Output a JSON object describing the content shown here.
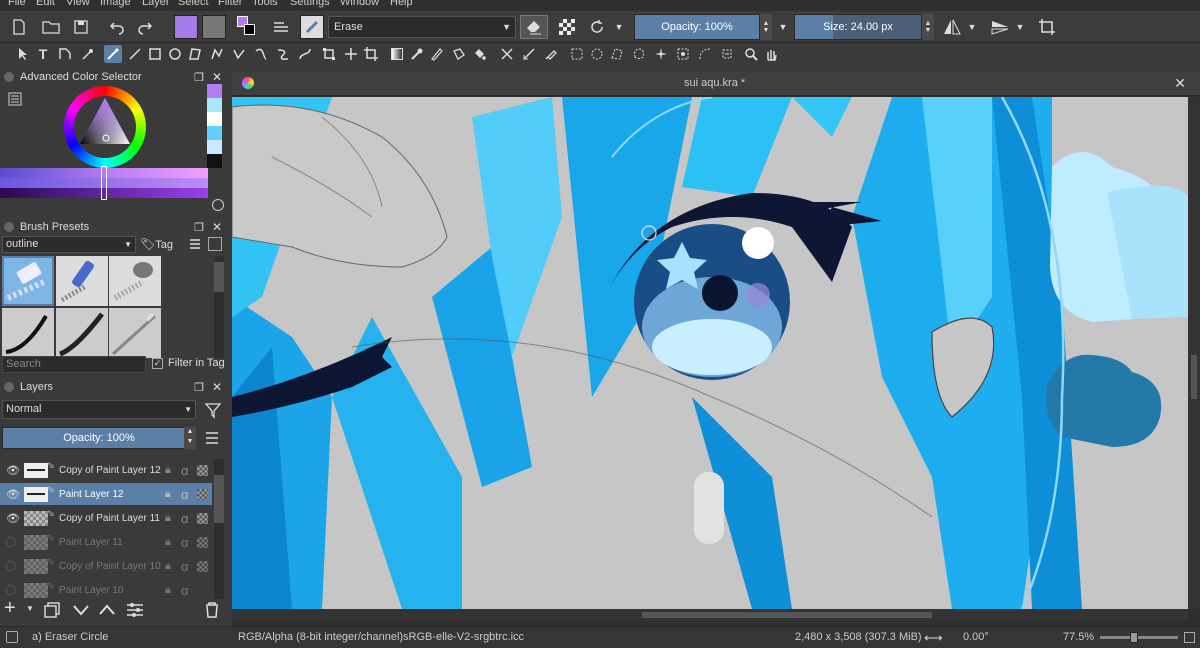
{
  "menu": [
    "File",
    "Edit",
    "View",
    "Image",
    "Layer",
    "Select",
    "Filter",
    "Tools",
    "Settings",
    "Window",
    "Help"
  ],
  "toolbar": {
    "blend_mode": "Erase",
    "opacity_label": "Opacity: 100%",
    "size_label": "Size: 24.00 px"
  },
  "color_selector": {
    "title": "Advanced Color Selector"
  },
  "brush_presets": {
    "title": "Brush Presets",
    "tag_filter": "outline",
    "tag_button": "Tag",
    "search_placeholder": "Search",
    "filter_in_tag": "Filter in Tag"
  },
  "layers": {
    "title": "Layers",
    "blend_mode": "Normal",
    "opacity_label": "Opacity:  100%",
    "items": [
      {
        "name": "Copy of Paint Layer 12",
        "visible": true
      },
      {
        "name": "Paint Layer 12",
        "visible": true,
        "selected": true
      },
      {
        "name": "Copy of Paint Layer 11",
        "visible": true
      },
      {
        "name": "Paint Layer 11",
        "visible": false
      },
      {
        "name": "Copy of Paint Layer 10",
        "visible": false
      },
      {
        "name": "Paint Layer 10",
        "visible": false
      }
    ]
  },
  "document": {
    "tab_title": "sui aqu.kra *"
  },
  "status": {
    "tool": "a) Eraser Circle",
    "color_space": "RGB/Alpha (8-bit integer/channel)",
    "profile": "sRGB-elle-V2-srgbtrc.icc",
    "dimensions": "2,480 x 3,508 (307.3 MiB)",
    "rotation": "0.00°",
    "zoom": "77.5%"
  },
  "colors": {
    "accent": "#5b7fa6",
    "fg_swatch": "#b47cf0"
  }
}
